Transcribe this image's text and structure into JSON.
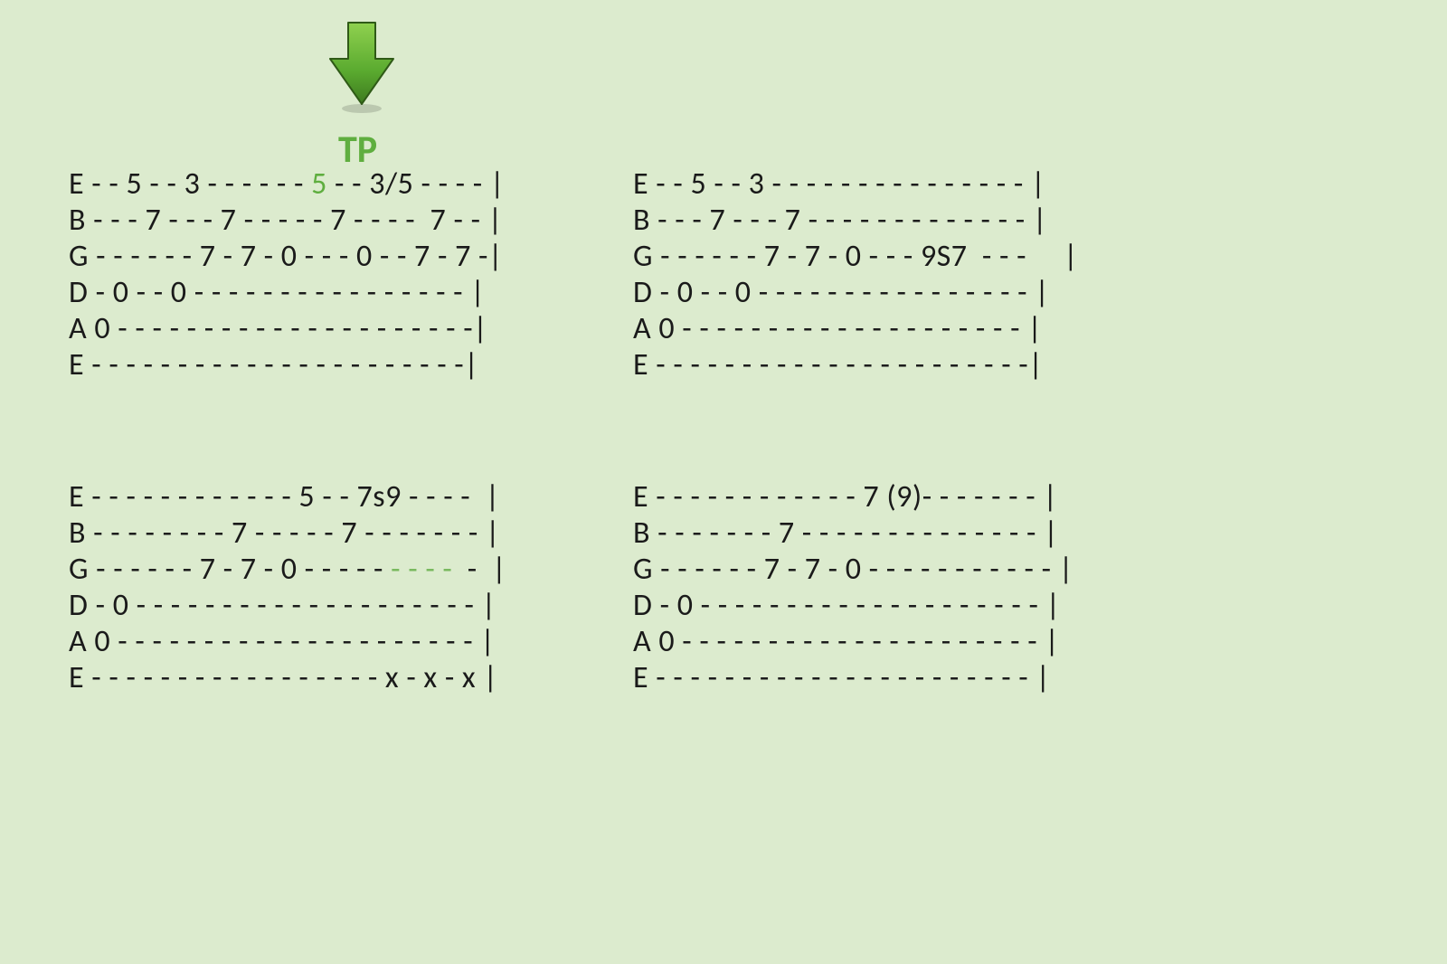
{
  "annotation": {
    "label": "TP"
  },
  "tab_blocks": {
    "b1": {
      "e_hi_pre": "E - - 5 - - 3 - - - - - - ",
      "e_hi_accent": "5",
      "e_hi_post": " - - 3/5 - - - - |",
      "b": "B - - - 7 - - - 7 - - - - - 7 - - - -  7 - - |",
      "g": "G - - - - - - 7 - 7 - 0 - - - 0 - - 7 - 7 -|",
      "d": "D - 0 - - 0 - - - - - - - - - - - - - - - - |",
      "a": "A 0 - - - - - - - - - - - - - - - - - - - - -|",
      "e_lo": "E - - - - - - - - - - - - - - - - - - - - - -|"
    },
    "b2": {
      "e_hi": "E - - 5 - - 3 - - - - - - - - - - - - - - - |",
      "b": "B - - - 7 - - - 7 - - - - - - - - - - - - - |",
      "g": "G - - - - - - 7 - 7 - 0 - - - 9S7  - - -     |",
      "d": "D - 0 - - 0 - - - - - - - - - - - - - - - - |",
      "a": "A 0 - - - - - - - - - - - - - - - - - - - - |",
      "e_lo": "E - - - - - - - - - - - - - - - - - - - - - -|"
    },
    "b3": {
      "e_hi": "E - - - - - - - - - - - - 5 - - 7s9 - - - -  |",
      "b": "B - - - - - - - - 7 - - - - - 7 - - - - - - - |",
      "g_pre": "G - - - - - - 7 - 7 - 0 - - - - -",
      "g_accent": " - - - -",
      "g_post": "  -  |",
      "d": "D - 0 - - - - - - - - - - - - - - - - - - - - |",
      "a": "A 0 - - - - - - - - - - - - - - - - - - - - - |",
      "e_lo": "E - - - - - - - - - - - - - - - - - x - x - x |"
    },
    "b4": {
      "e_hi": "E - - - - - - - - - - - - 7 (9)- - - - - - - |",
      "b": "B - - - - - - - 7 - - - - - - - - - - - - - - |",
      "g": "G - - - - - - 7 - 7 - 0 - - - - - - - - - - - |",
      "d": "D - 0 - - - - - - - - - - - - - - - - - - - - |",
      "a": "A 0 - - - - - - - - - - - - - - - - - - - - - |",
      "e_lo": "E - - - - - - - - - - - - - - - - - - - - - - |"
    }
  }
}
